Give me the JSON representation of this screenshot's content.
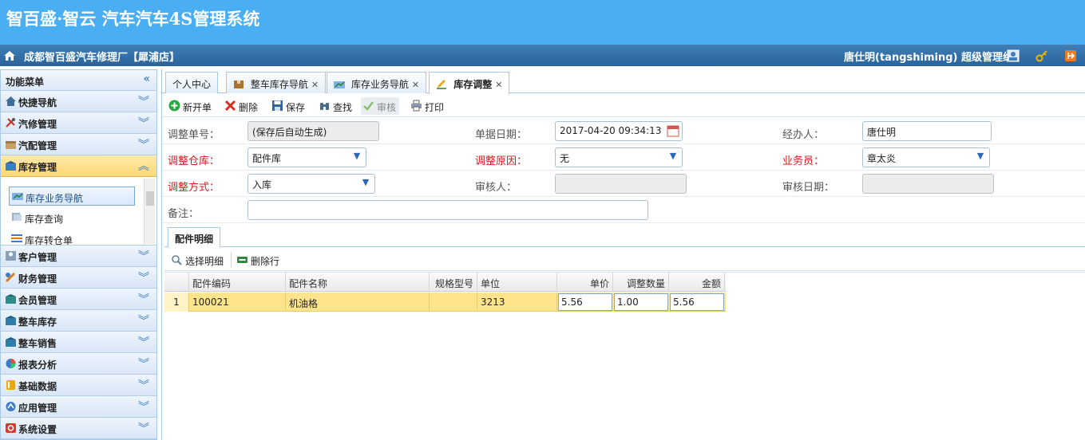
{
  "app": {
    "title": "智百盛·智云 汽车汽车4S管理系统"
  },
  "infobar": {
    "shop": "成都智百盛汽车修理厂【犀浦店】",
    "user": "唐仕明(tangshiming)  超级管理组"
  },
  "sidebar": {
    "title": "功能菜单",
    "groups": [
      {
        "label": "快捷导航",
        "icon": "home-icon"
      },
      {
        "label": "汽修管理",
        "icon": "wrench-icon"
      },
      {
        "label": "汽配管理",
        "icon": "box-icon"
      },
      {
        "label": "库存管理",
        "icon": "warehouse-icon"
      },
      {
        "label": "客户管理",
        "icon": "contact-icon"
      },
      {
        "label": "财务管理",
        "icon": "finance-icon"
      },
      {
        "label": "会员管理",
        "icon": "member-icon"
      },
      {
        "label": "整车库存",
        "icon": "car-stock-icon"
      },
      {
        "label": "整车销售",
        "icon": "car-sale-icon"
      },
      {
        "label": "报表分析",
        "icon": "pie-chart-icon"
      },
      {
        "label": "基础数据",
        "icon": "database-icon"
      },
      {
        "label": "应用管理",
        "icon": "app-icon"
      },
      {
        "label": "系统设置",
        "icon": "settings-icon"
      }
    ],
    "sub_items": [
      "库存业务导航",
      "库存查询",
      "库存转仓单"
    ]
  },
  "tabs": [
    {
      "label": "个人中心"
    },
    {
      "label": "整车库存导航"
    },
    {
      "label": "库存业务导航"
    },
    {
      "label": "库存调整"
    }
  ],
  "toolbar": {
    "new": "新开单",
    "delete": "删除",
    "save": "保存",
    "find": "查找",
    "audit": "审核",
    "print": "打印"
  },
  "form": {
    "doc_no_label": "调整单号：",
    "doc_no_value": "(保存后自动生成)",
    "date_label": "单据日期：",
    "date_value": "2017-04-20 09:34:13",
    "handler_label": "经办人：",
    "handler_value": "唐仕明",
    "warehouse_label": "调整仓库：",
    "warehouse_value": "配件库",
    "reason_label": "调整原因：",
    "reason_value": "无",
    "sales_label": "业务员：",
    "sales_value": "章太炎",
    "method_label": "调整方式：",
    "method_value": "入库",
    "auditor_label": "审核人：",
    "auditor_value": "",
    "audit_date_label": "审核日期：",
    "audit_date_value": "",
    "remark_label": "备注：",
    "remark_value": ""
  },
  "detail": {
    "tab": "配件明细",
    "select_btn": "选择明细",
    "delete_btn": "删除行",
    "columns": [
      "配件编码",
      "配件名称",
      "规格型号",
      "单位",
      "单价",
      "调整数量",
      "金额"
    ],
    "rows": [
      {
        "no": "1",
        "code": "100021",
        "name": "机油格",
        "spec": "",
        "unit": "3213",
        "price": "5.56",
        "qty": "1.00",
        "amount": "5.56"
      }
    ]
  }
}
